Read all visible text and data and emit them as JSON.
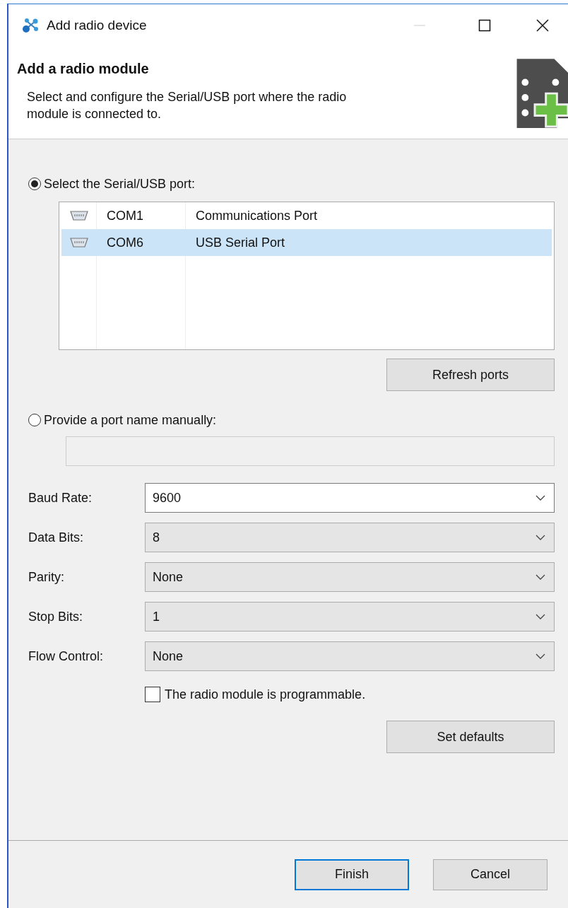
{
  "window": {
    "title": "Add radio device",
    "minimize_disabled": true
  },
  "header": {
    "title": "Add a radio module",
    "description": "Select and configure the Serial/USB port where the radio module is connected to."
  },
  "port_modes": [
    {
      "label": "Select the Serial/USB port:",
      "selected": true
    },
    {
      "label": "Provide a port name manually:",
      "selected": false
    }
  ],
  "ports": [
    {
      "port": "COM1",
      "description": "Communications Port",
      "selected": false
    },
    {
      "port": "COM6",
      "description": "USB Serial Port",
      "selected": true
    }
  ],
  "refresh_button": "Refresh ports",
  "manual_port": {
    "disabled": true
  },
  "settings": [
    {
      "label": "Baud Rate:",
      "value": "9600",
      "editable": true
    },
    {
      "label": "Data Bits:",
      "value": "8",
      "editable": false
    },
    {
      "label": "Parity:",
      "value": "None",
      "editable": false
    },
    {
      "label": "Stop Bits:",
      "value": "1",
      "editable": false
    },
    {
      "label": "Flow Control:",
      "value": "None",
      "editable": false
    }
  ],
  "programmable": {
    "label": "The radio module is programmable.",
    "checked": false
  },
  "defaults_button": "Set defaults",
  "buttons": [
    {
      "label": "Finish",
      "default": true
    },
    {
      "label": "Cancel",
      "default": false
    }
  ]
}
